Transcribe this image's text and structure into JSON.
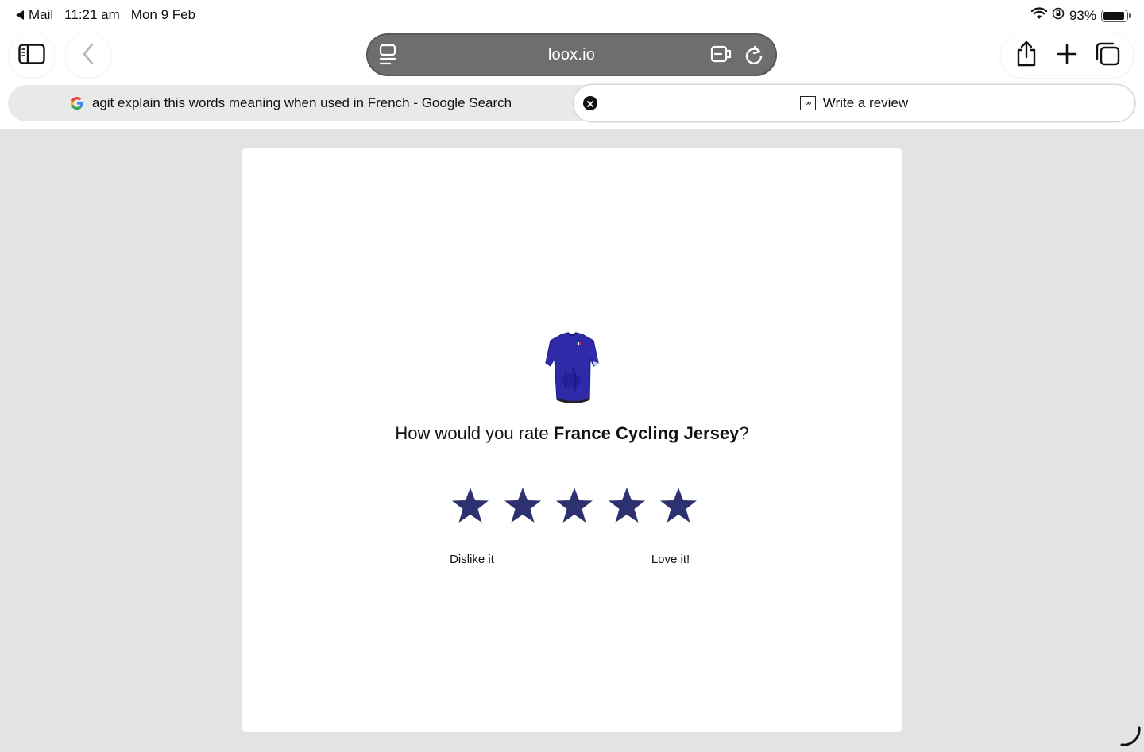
{
  "status_bar": {
    "back_app": "Mail",
    "time": "11:21 am",
    "date": "Mon 9 Feb",
    "battery": "93%",
    "battery_level": 0.93
  },
  "toolbar": {
    "url": "loox.io"
  },
  "tabs": [
    {
      "title": "agit explain this words meaning when used in French - Google Search",
      "active": false
    },
    {
      "title": "Write a review",
      "active": true
    }
  ],
  "review": {
    "question_prefix": "How would you rate ",
    "product_name": "France Cycling Jersey",
    "question_suffix": "?",
    "star_count": 5,
    "low_label": "Dislike it",
    "high_label": "Love it!",
    "star_color": "#2e3170"
  },
  "colors": {
    "background": "#e3e3e3",
    "address_bar": "#6e6e6e",
    "card": "#ffffff"
  }
}
